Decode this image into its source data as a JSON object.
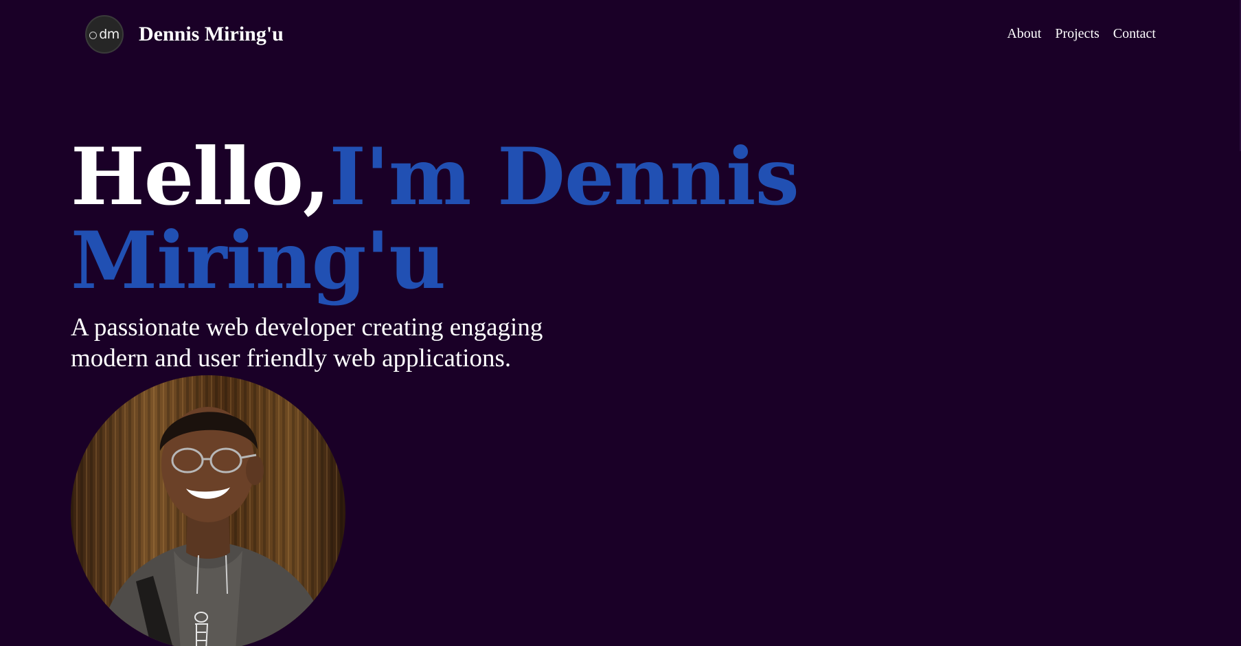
{
  "header": {
    "logo_text": "dm",
    "brand_name": "Dennis Miring'u",
    "nav": [
      {
        "label": "About"
      },
      {
        "label": "Projects"
      },
      {
        "label": "Contact"
      }
    ]
  },
  "hero": {
    "greeting": "Hello,",
    "name": "I'm Dennis Miring'u",
    "tagline": "A passionate web developer creating engaging modern and user friendly web applications."
  },
  "colors": {
    "background": "#1a0027",
    "accent": "#2150b3",
    "text": "#ffffff"
  },
  "icons": {
    "logo": "dm-monogram-icon",
    "photo": "profile-photo"
  }
}
